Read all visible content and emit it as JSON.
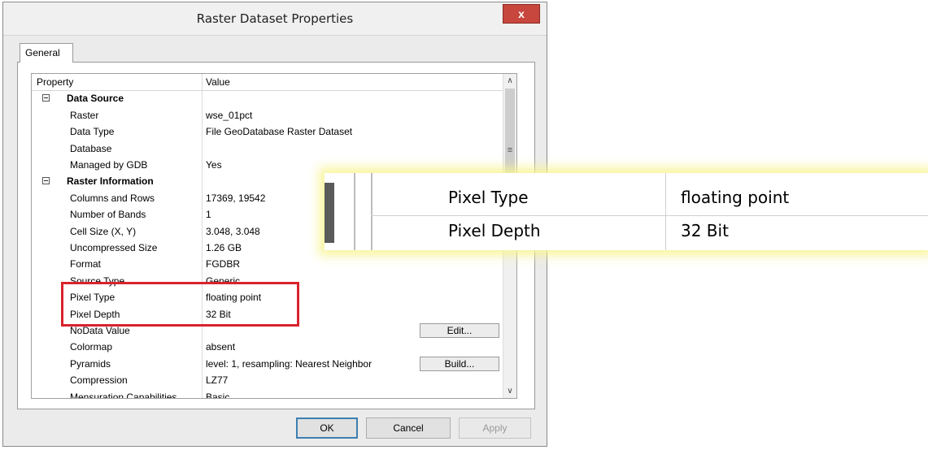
{
  "dialog": {
    "title": "Raster Dataset Properties",
    "close_label": "x",
    "tab_label": "General"
  },
  "grid": {
    "header": {
      "property": "Property",
      "value": "Value"
    },
    "rows": [
      {
        "kind": "category",
        "name": "Data Source",
        "value": ""
      },
      {
        "kind": "prop",
        "name": "Raster",
        "value": "wse_01pct"
      },
      {
        "kind": "prop",
        "name": "Data Type",
        "value": "File GeoDatabase Raster Dataset"
      },
      {
        "kind": "prop",
        "name": "Database",
        "value": ""
      },
      {
        "kind": "prop",
        "name": "Managed by GDB",
        "value": "Yes"
      },
      {
        "kind": "category",
        "name": "Raster Information",
        "value": ""
      },
      {
        "kind": "prop",
        "name": "Columns and Rows",
        "value": "17369, 19542"
      },
      {
        "kind": "prop",
        "name": "Number of Bands",
        "value": "1"
      },
      {
        "kind": "prop",
        "name": "Cell Size (X, Y)",
        "value": "3.048, 3.048"
      },
      {
        "kind": "prop",
        "name": "Uncompressed Size",
        "value": "1.26 GB"
      },
      {
        "kind": "prop",
        "name": "Format",
        "value": "FGDBR"
      },
      {
        "kind": "prop",
        "name": "Source Type",
        "value": "Generic"
      },
      {
        "kind": "prop",
        "name": "Pixel Type",
        "value": "floating point"
      },
      {
        "kind": "prop",
        "name": "Pixel Depth",
        "value": "32 Bit"
      },
      {
        "kind": "prop",
        "name": "NoData Value",
        "value": "",
        "button": "Edit..."
      },
      {
        "kind": "prop",
        "name": "Colormap",
        "value": "absent"
      },
      {
        "kind": "prop",
        "name": "Pyramids",
        "value": "level: 1, resampling: Nearest Neighbor",
        "button": "Build..."
      },
      {
        "kind": "prop",
        "name": "Compression",
        "value": "LZ77"
      },
      {
        "kind": "prop",
        "name": "Mensuration Capabilities",
        "value": "Basic"
      }
    ]
  },
  "scrollbar": {
    "up": "∧",
    "down": "∨",
    "grip": "≡"
  },
  "buttons": {
    "ok": "OK",
    "cancel": "Cancel",
    "apply": "Apply"
  },
  "zoom": {
    "rows": [
      {
        "name": "Pixel Type",
        "value": "floating point"
      },
      {
        "name": "Pixel Depth",
        "value": "32 Bit"
      }
    ]
  },
  "colors": {
    "highlight": "#d9232d",
    "glow": "#f8f496"
  }
}
